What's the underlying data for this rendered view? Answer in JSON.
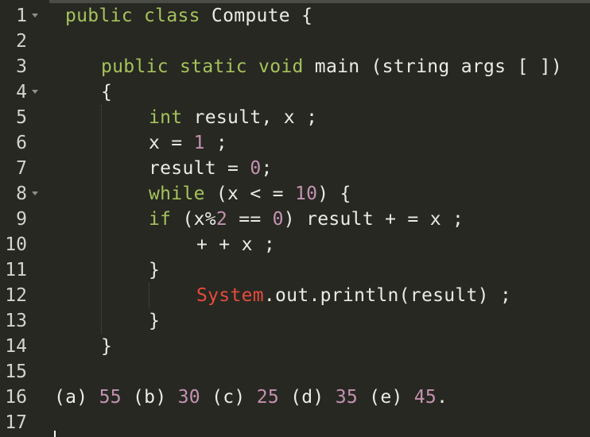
{
  "line_numbers": [
    "1",
    "2",
    "3",
    "4",
    "5",
    "6",
    "7",
    "8",
    "9",
    "10",
    "11",
    "12",
    "13",
    "14",
    "15",
    "16",
    "17"
  ],
  "code": {
    "l1": {
      "kw": "public class",
      "rest": " Compute {"
    },
    "l3": {
      "kw": "public static void",
      "rest": " main (string args [ ])"
    },
    "l4": {
      "text": "{"
    },
    "l5": {
      "kw": "int",
      "rest": " result, x ;"
    },
    "l6": {
      "a": "x = ",
      "num": "1",
      "b": " ;"
    },
    "l7": {
      "a": "result = ",
      "num": "0",
      "b": ";"
    },
    "l8": {
      "kw": "while",
      "a": " (x < = ",
      "num": "10",
      "b": ") {"
    },
    "l9": {
      "kw": "if",
      "a": " (x%",
      "num1": "2",
      "b": " == ",
      "num2": "0",
      "c": ") result + = x ;"
    },
    "l10": {
      "text": "+ + x ;"
    },
    "l11": {
      "text": "}"
    },
    "l12": {
      "red": "System",
      "rest": ".out.println(result) ;"
    },
    "l13": {
      "text": "}"
    },
    "l14": {
      "text": "}"
    },
    "l16": {
      "a": "(a) ",
      "va": "55",
      "b": " (b) ",
      "vb": "30",
      "c": " (c) ",
      "vc": "25",
      "d": " (d) ",
      "vd": "35",
      "e": " (e) ",
      "ve": "45",
      "end": "."
    }
  },
  "colors": {
    "background": "#272822",
    "keyword": "#a5c25c",
    "number": "#c492b1",
    "class_name": "#e64b3c",
    "text": "#ebebe5"
  }
}
